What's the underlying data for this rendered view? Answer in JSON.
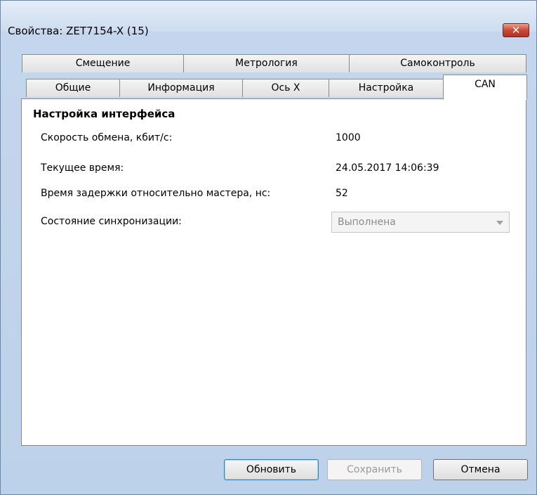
{
  "window": {
    "title": "Свойства: ZET7154-X (15)",
    "close_symbol": "✕"
  },
  "tabs": {
    "row_top": [
      {
        "label": "Смещение"
      },
      {
        "label": "Метрология"
      },
      {
        "label": "Самоконтроль"
      }
    ],
    "row_bottom": [
      {
        "label": "Общие"
      },
      {
        "label": "Информация"
      },
      {
        "label": "Ось X"
      },
      {
        "label": "Настройка"
      },
      {
        "label": "CAN",
        "active": true
      }
    ]
  },
  "panel": {
    "section_title": "Настройка интерфейса",
    "rows": [
      {
        "label": "Скорость обмена, кбит/с:",
        "value": "1000"
      },
      {
        "label": "Текущее время:",
        "value": "24.05.2017 14:06:39"
      },
      {
        "label": "Время задержки относительно мастера, нс:",
        "value": "52"
      }
    ],
    "sync": {
      "label": "Состояние синхронизации:",
      "selected": "Выполнена"
    }
  },
  "buttons": {
    "refresh": "Обновить",
    "save": "Сохранить",
    "cancel": "Отмена"
  }
}
